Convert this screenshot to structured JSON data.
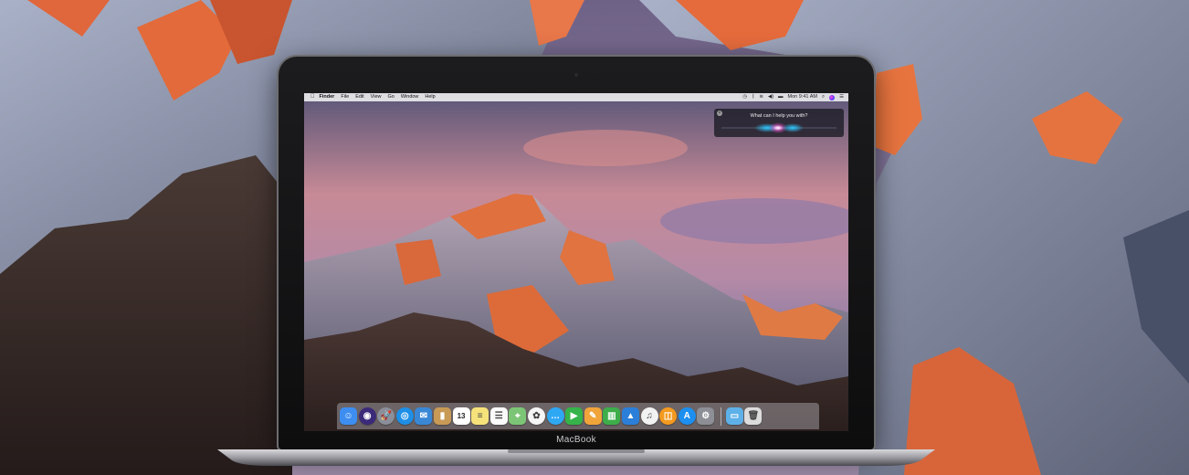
{
  "device": {
    "label": "MacBook"
  },
  "menubar": {
    "apple_icon": "apple-logo-icon",
    "items": [
      "Finder",
      "File",
      "Edit",
      "View",
      "Go",
      "Window",
      "Help"
    ],
    "status_icons": [
      "clock-icon",
      "bluetooth-icon",
      "wifi-icon",
      "volume-icon",
      "battery-icon"
    ],
    "clock": "Mon 9:41 AM",
    "spotlight_icon": "spotlight-search-icon",
    "siri_icon": "siri-icon",
    "notification_icon": "notification-center-icon"
  },
  "siri": {
    "prompt": "What can I help you with?",
    "close_icon": "close-icon"
  },
  "dock": {
    "apps": [
      {
        "name": "finder-icon",
        "glyph": "☺",
        "color": "#3d8ef0"
      },
      {
        "name": "siri-icon",
        "glyph": "◉",
        "color": "#3b2a7a"
      },
      {
        "name": "launchpad-icon",
        "glyph": "🚀",
        "color": "#8a8f99"
      },
      {
        "name": "safari-icon",
        "glyph": "◎",
        "color": "#1e8fe6"
      },
      {
        "name": "mail-icon",
        "glyph": "✉",
        "color": "#3a87d6"
      },
      {
        "name": "contacts-icon",
        "glyph": "▮",
        "color": "#c89a55"
      },
      {
        "name": "calendar-icon",
        "glyph": "13",
        "color": "#ffffff"
      },
      {
        "name": "notes-icon",
        "glyph": "≡",
        "color": "#f6e27a"
      },
      {
        "name": "reminders-icon",
        "glyph": "☰",
        "color": "#fafafa"
      },
      {
        "name": "maps-icon",
        "glyph": "⌖",
        "color": "#7cc576"
      },
      {
        "name": "photos-icon",
        "glyph": "✿",
        "color": "#f5f5f5"
      },
      {
        "name": "messages-icon",
        "glyph": "…",
        "color": "#2fa8f4"
      },
      {
        "name": "facetime-icon",
        "glyph": "▶",
        "color": "#36b34a"
      },
      {
        "name": "pages-icon",
        "glyph": "✎",
        "color": "#f0a43a"
      },
      {
        "name": "numbers-icon",
        "glyph": "▥",
        "color": "#3dae4a"
      },
      {
        "name": "keynote-icon",
        "glyph": "▲",
        "color": "#2b7fd9"
      },
      {
        "name": "itunes-icon",
        "glyph": "♫",
        "color": "#f2f2f2"
      },
      {
        "name": "ibooks-icon",
        "glyph": "◫",
        "color": "#f39a1f"
      },
      {
        "name": "app-store-icon",
        "glyph": "A",
        "color": "#1c8ff0"
      },
      {
        "name": "system-preferences-icon",
        "glyph": "⚙",
        "color": "#8c8f96"
      }
    ],
    "stack": [
      {
        "name": "downloads-folder-icon",
        "glyph": "▭",
        "color": "#5eb1e8"
      },
      {
        "name": "trash-icon",
        "glyph": "🗑",
        "color": "#dcdcdc"
      }
    ]
  }
}
